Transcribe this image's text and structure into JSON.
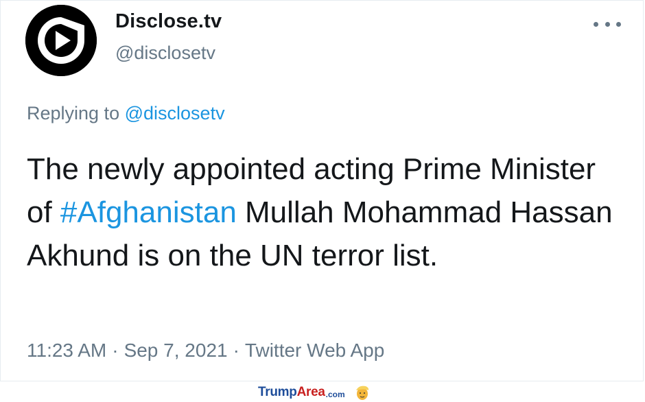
{
  "tweet": {
    "display_name": "Disclose.tv",
    "handle": "@disclosetv",
    "reply_prefix": "Replying to",
    "reply_mention": "@disclosetv",
    "text_part1": "The newly appointed acting Prime Minister of ",
    "hashtag": "#Afghanistan",
    "text_part2": " Mullah Mohammad Hassan Akhund is on the UN terror list.",
    "time": "11:23 AM",
    "separator": "·",
    "date": "Sep 7, 2021",
    "source": "Twitter Web App"
  },
  "icons": {
    "avatar": "disclosetv-logo-icon",
    "more": "more-dots-icon",
    "watermark_face": "trump-face-icon"
  },
  "watermark": {
    "brand_part1": "Trump",
    "brand_part2": "Area",
    "brand_suffix": ".com"
  },
  "colors": {
    "link": "#1b95e0",
    "text": "#14171a",
    "muted": "#657786",
    "watermark_blue": "#1e4d9a",
    "watermark_red": "#c8201f"
  }
}
